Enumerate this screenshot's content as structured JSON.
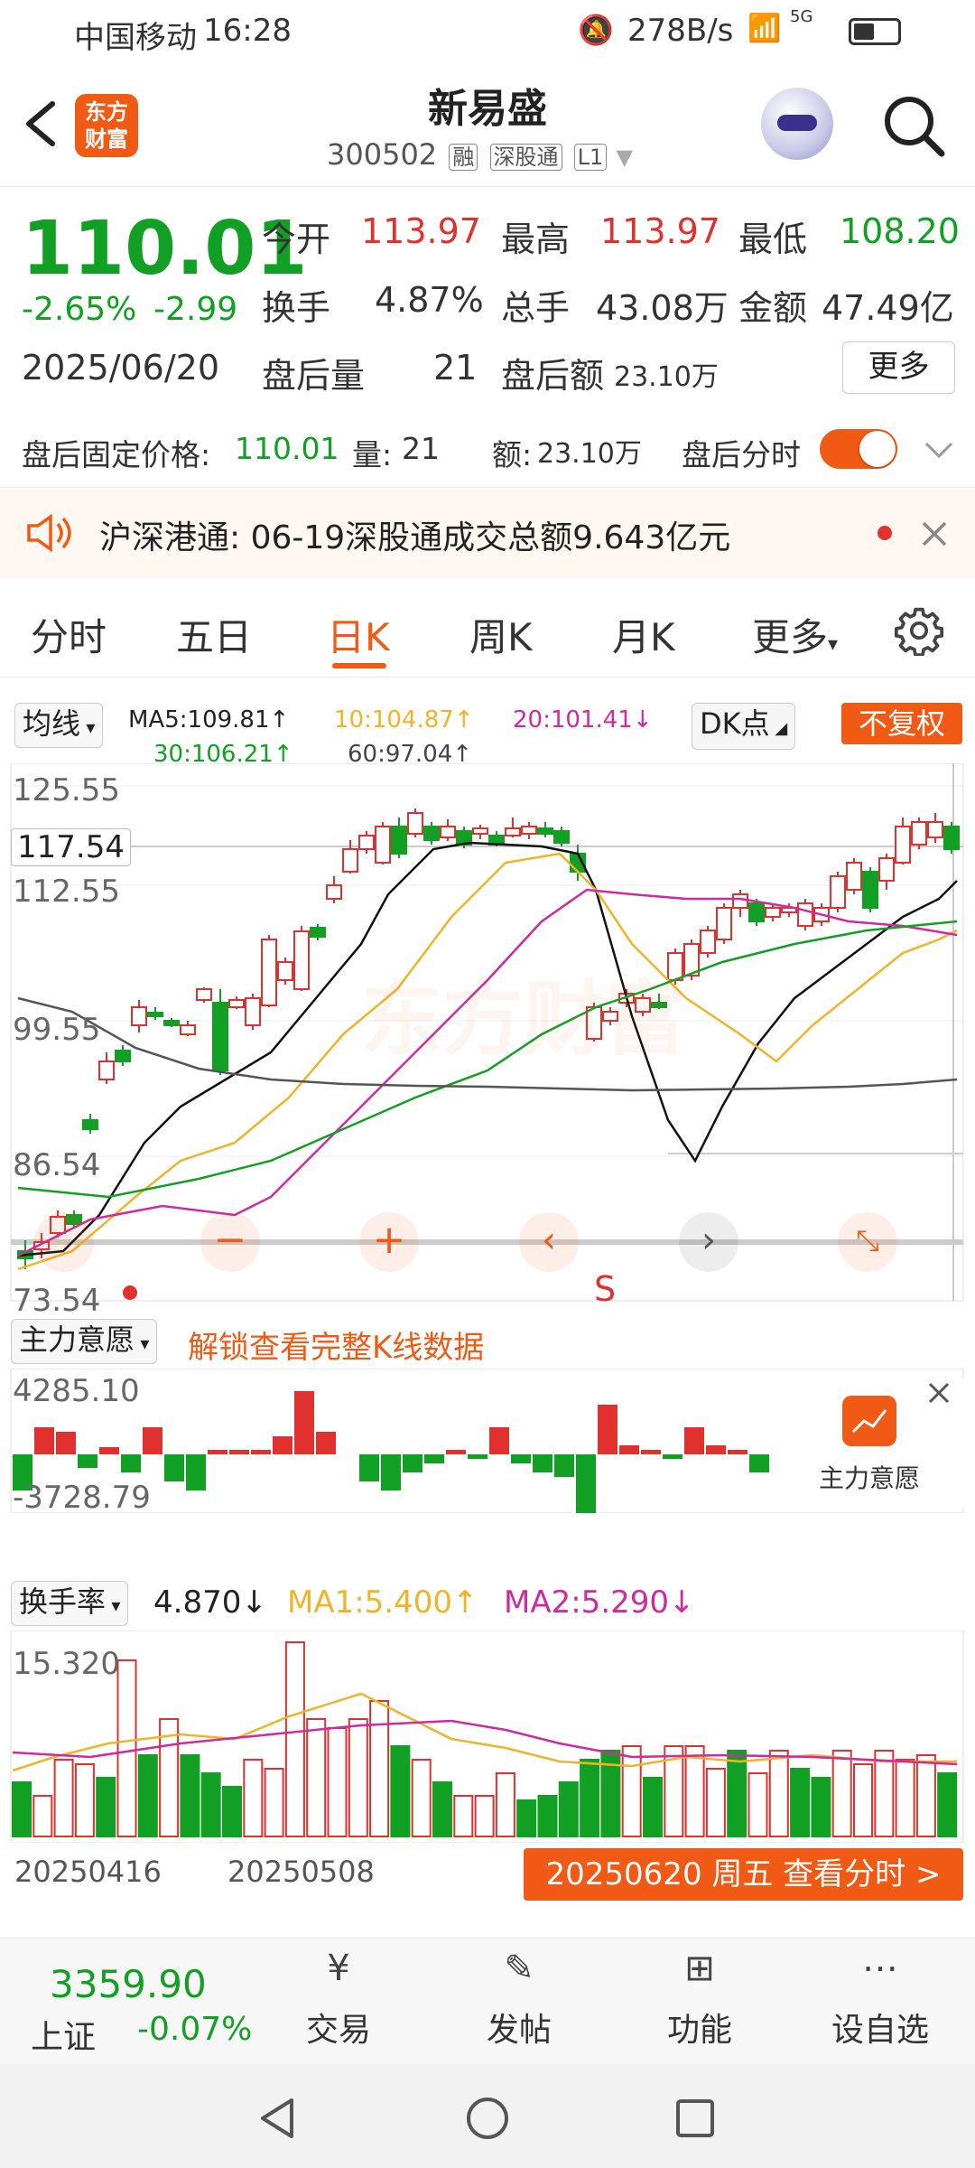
{
  "status": {
    "carrier": "中国移动",
    "time": "16:28",
    "speed": "278B/s",
    "network": "5G"
  },
  "header": {
    "logo": "东方财富",
    "name": "新易盛",
    "code": "300502",
    "badges": [
      "融",
      "深股通",
      "L1"
    ]
  },
  "quote": {
    "price": "110.01",
    "change_pct": "-2.65%",
    "change": "-2.99",
    "date": "2025/06/20",
    "open_label": "今开",
    "open": "113.97",
    "high_label": "最高",
    "high": "113.97",
    "low_label": "最低",
    "low": "108.20",
    "turnover_label": "换手",
    "turnover": "4.87%",
    "volume_label": "总手",
    "volume": "43.08万",
    "amount_label": "金额",
    "amount": "47.49亿",
    "after_vol_label": "盘后量",
    "after_vol": "21",
    "after_amt_label": "盘后额",
    "after_amt": "23.10万",
    "more": "更多"
  },
  "afterbar": {
    "price_label": "盘后固定价格:",
    "price": "110.01",
    "qty_label": "量:",
    "qty": "21",
    "amt_label": "额:",
    "amt": "23.10万",
    "switch_label": "盘后分时"
  },
  "notice": {
    "text": "沪深港通:  06-19深股通成交总额9.643亿元"
  },
  "tabs": [
    "分时",
    "五日",
    "日K",
    "周K",
    "月K",
    "更多"
  ],
  "active_tab": "日K",
  "kline": {
    "ma_label": "均线",
    "ma5": "MA5:109.81",
    "ma10": "10:104.87",
    "ma20": "20:101.41",
    "ma30": "30:106.21",
    "ma60": "60:97.04",
    "dk": "DK点",
    "fq": "不复权",
    "y_ticks": [
      "125.55",
      "112.55",
      "99.55",
      "86.54",
      "73.54"
    ],
    "cursor": "117.54",
    "signal": "S",
    "watermark": "东方财富"
  },
  "flow": {
    "label": "主力意愿",
    "unlock": "解锁查看完整K线数据",
    "max": "4285.10",
    "min": "-3728.79",
    "panel": "主力意愿"
  },
  "turn": {
    "label": "换手率",
    "value": "4.870",
    "ma1": "MA1:5.400",
    "ma2": "MA2:5.290",
    "max": "15.320"
  },
  "dates": {
    "d1": "20250416",
    "d2": "20250508",
    "banner": "20250620 周五 查看分时 >"
  },
  "bottom": {
    "index_val": "3359.90",
    "index_name": "上证",
    "index_chg": "-0.07%",
    "items": [
      "交易",
      "发帖",
      "功能",
      "设自选"
    ]
  },
  "colors": {
    "up": "#e0312f",
    "down": "#12a024",
    "accent": "#f05a14"
  }
}
